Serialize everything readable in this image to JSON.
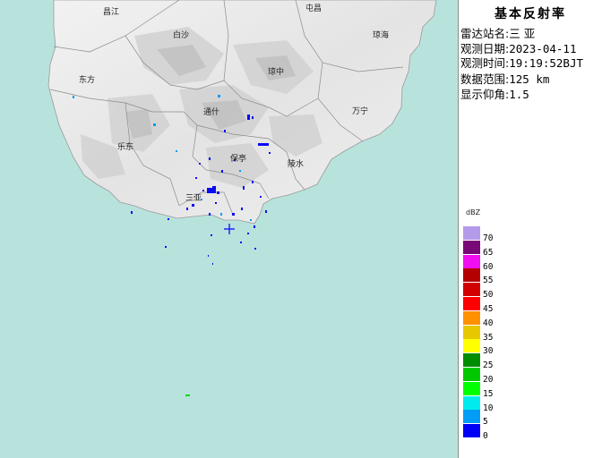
{
  "panel": {
    "title": "基本反射率",
    "station_label": "雷达站名:",
    "station_value": "三 亚",
    "date_label": "观测日期:",
    "date_value": "2023-04-11",
    "time_label": "观测时间:",
    "time_value": "19:19:52BJT",
    "range_label": "数据范围:",
    "range_value": "125 km",
    "elev_label": "显示仰角:",
    "elev_value": "1.5"
  },
  "legend": {
    "unit": "dBZ",
    "items": [
      {
        "value": "70",
        "color": "#b49bea"
      },
      {
        "value": "65",
        "color": "#780a78"
      },
      {
        "value": "60",
        "color": "#f00ff0"
      },
      {
        "value": "55",
        "color": "#b40000"
      },
      {
        "value": "50",
        "color": "#d20000"
      },
      {
        "value": "45",
        "color": "#ff0000"
      },
      {
        "value": "40",
        "color": "#ff9000"
      },
      {
        "value": "35",
        "color": "#e6c800"
      },
      {
        "value": "30",
        "color": "#ffff00"
      },
      {
        "value": "25",
        "color": "#008c00"
      },
      {
        "value": "20",
        "color": "#00c800"
      },
      {
        "value": "15",
        "color": "#00ff00"
      },
      {
        "value": "10",
        "color": "#00ecec"
      },
      {
        "value": "5",
        "color": "#009cf5"
      },
      {
        "value": "0",
        "color": "#0000f6"
      }
    ]
  },
  "cities": [
    {
      "name": "昌江"
    },
    {
      "name": "屯昌"
    },
    {
      "name": "白沙"
    },
    {
      "name": "琼海"
    },
    {
      "name": "琼中"
    },
    {
      "name": "东方"
    },
    {
      "name": "通什"
    },
    {
      "name": "万宁"
    },
    {
      "name": "乐东"
    },
    {
      "name": "保亭"
    },
    {
      "name": "陵水"
    },
    {
      "name": "三亚"
    }
  ],
  "colors": {
    "sea": "#b8e3dc",
    "land": "#ececec",
    "radar_site": "#1a1aff"
  }
}
